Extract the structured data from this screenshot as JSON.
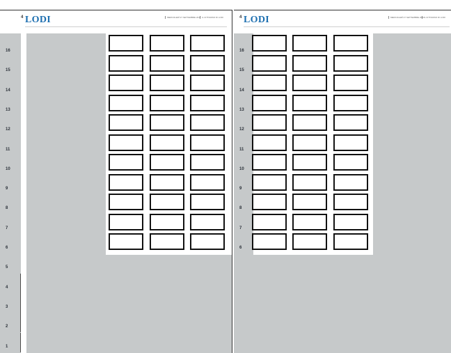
{
  "left_page": {
    "page_number": "4",
    "masthead": "LODI",
    "dateline": "MERCOLEDÌ 27 SETTEMBRE 2017",
    "section": "IL CITTADINO DI LODI"
  },
  "right_page": {
    "page_number": "4",
    "masthead": "LODI",
    "dateline": "MERCOLEDÌ 27 SETTEMBRE 2017",
    "section": "IL CITTADINO DI LODI"
  },
  "left_row_labels": [
    "16",
    "15",
    "14",
    "13",
    "12",
    "11",
    "10",
    "9",
    "8",
    "7",
    "6",
    "5",
    "4",
    "3",
    "2",
    "1"
  ],
  "right_row_labels": [
    "16",
    "15",
    "14",
    "13",
    "12",
    "11",
    "10",
    "9",
    "8",
    "7",
    "6"
  ],
  "grid": {
    "columns": 3,
    "rows": 11
  },
  "colors": {
    "masthead": "#1d6fb0",
    "background_area": "#c6c9ca",
    "cell_border": "#111111"
  }
}
